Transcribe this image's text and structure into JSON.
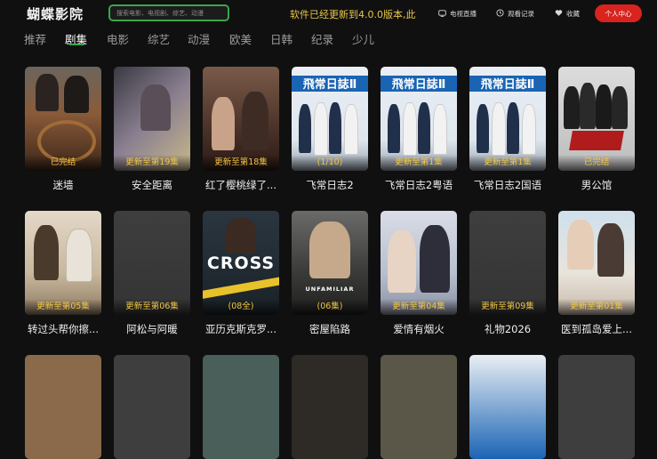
{
  "header": {
    "logo": "蝴蝶影院",
    "search_placeholder": "搜索电影、电视剧、综艺、动漫",
    "notice": "软件已经更新到4.0.0版本,此",
    "tv_live_label": "电视直播",
    "history_label": "观看记录",
    "favorites_label": "收藏",
    "user_center_label": "个人中心",
    "icons": [
      "tv-icon",
      "clock-icon",
      "heart-icon"
    ]
  },
  "tabs": [
    {
      "label": "推荐",
      "active": false
    },
    {
      "label": "剧集",
      "active": true
    },
    {
      "label": "电影",
      "active": false
    },
    {
      "label": "综艺",
      "active": false
    },
    {
      "label": "动漫",
      "active": false
    },
    {
      "label": "欧美",
      "active": false
    },
    {
      "label": "日韩",
      "active": false
    },
    {
      "label": "纪录",
      "active": false
    },
    {
      "label": "少儿",
      "active": false
    }
  ],
  "colors": {
    "accent": "#3aa64a",
    "badge": "#f0c541",
    "user_button": "#d9231f",
    "notice": "#e8c64a"
  },
  "rows": [
    {
      "items": [
        {
          "title": "迷墙",
          "badge": "已完结"
        },
        {
          "title": "安全距离",
          "badge": "更新至第19集"
        },
        {
          "title": "红了樱桃绿了...",
          "badge": "更新至第18集"
        },
        {
          "title": "飞常日志2",
          "badge": "(1/10)",
          "poster_text": "飛常日誌Ⅱ"
        },
        {
          "title": "飞常日志2粤语",
          "badge": "更新至第1集",
          "poster_text": "飛常日誌Ⅱ"
        },
        {
          "title": "飞常日志2国语",
          "badge": "更新至第1集",
          "poster_text": "飛常日誌Ⅱ"
        },
        {
          "title": "男公馆",
          "badge": "已完结"
        }
      ]
    },
    {
      "items": [
        {
          "title": "转过头帮你擦...",
          "badge": "更新至第05集"
        },
        {
          "title": "阿松与阿暖",
          "badge": "更新至第06集"
        },
        {
          "title": "亚历克斯克罗...",
          "badge": "(08全)",
          "poster_text": "CROSS"
        },
        {
          "title": "密屋陷路",
          "badge": "(06集)",
          "poster_text": "UNFAMILIAR"
        },
        {
          "title": "爱情有烟火",
          "badge": "更新至第04集"
        },
        {
          "title": "礼物2026",
          "badge": "更新至第09集"
        },
        {
          "title": "医到孤岛爱上...",
          "badge": "更新至第01集"
        }
      ]
    }
  ]
}
